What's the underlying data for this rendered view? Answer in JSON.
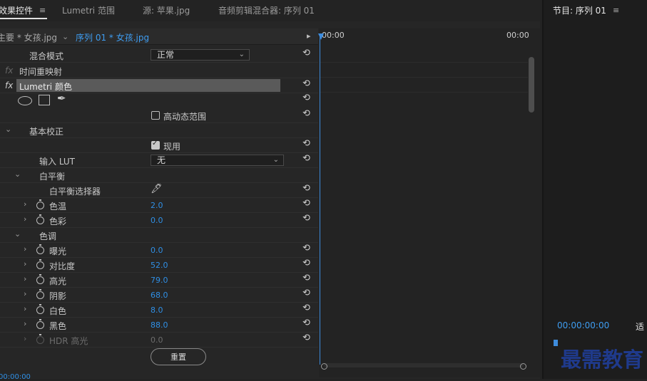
{
  "tabs": {
    "effect_controls": "效果控件",
    "lumetri_scopes": "Lumetri 范围",
    "source": "源: 苹果.jpg",
    "audio_mixer": "音频剪辑混合器: 序列 01",
    "menu_icon": "≡"
  },
  "sub_tabs": {
    "master": "主要 * 女孩.jpg",
    "clip": "序列 01 * 女孩.jpg"
  },
  "timeline": {
    "start_time": "00:00",
    "end_time": "00:00"
  },
  "effects": {
    "blend_mode_label": "混合模式",
    "blend_mode_value": "正常",
    "time_remap": "时间重映射",
    "lumetri_color": "Lumetri 颜色",
    "high_dynamic_range": "高动态范围",
    "basic_correction": "基本校正",
    "enable": "现用",
    "input_lut_label": "输入 LUT",
    "input_lut_value": "无",
    "white_balance": "白平衡",
    "wb_selector": "白平衡选择器",
    "temperature": "色温",
    "temperature_value": "2.0",
    "tint": "色彩",
    "tint_value": "0.0",
    "tone": "色调",
    "exposure": "曝光",
    "exposure_value": "0.0",
    "contrast": "对比度",
    "contrast_value": "52.0",
    "highlights": "高光",
    "highlights_value": "79.0",
    "shadows": "阴影",
    "shadows_value": "68.0",
    "whites": "白色",
    "whites_value": "8.0",
    "blacks": "黑色",
    "blacks_value": "88.0",
    "hdr_highlights": "HDR 高光",
    "hdr_highlights_value": "0.0",
    "reset_button": "重置"
  },
  "footer": {
    "timecode": "00:00:00"
  },
  "program": {
    "title": "节目: 序列 01",
    "timecode": "00:00:00:00",
    "fit": "适"
  },
  "watermark": "最需教育",
  "colors": {
    "accent_blue": "#2f8fe5",
    "playhead": "#3e8cdc",
    "panel_bg": "#262626"
  }
}
